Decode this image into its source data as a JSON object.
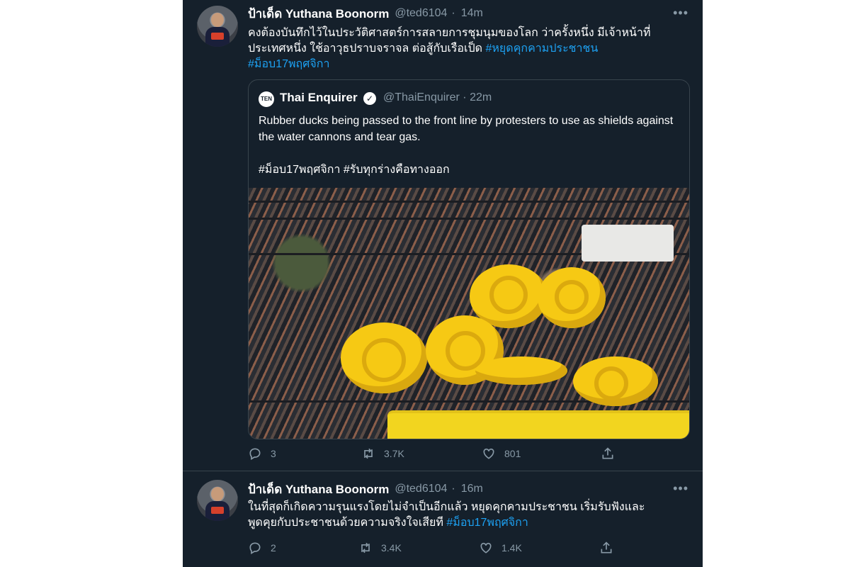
{
  "tweet1": {
    "name": "ป้าเด็ด Yuthana Boonorm",
    "handle": "@ted6104",
    "dot": "·",
    "time": "14m",
    "more": "•••",
    "text_line1": "คงต้องบันทึกไว้ในประวัติศาสตร์การสลายการชุมนุมของโลก ว่าครั้งหนึ่ง มีเจ้าหน้าที่",
    "text_line2": "ประเทศหนึ่ง ใช้อาวุธปราบจราจล ต่อสู้กับเรือเป็ด ",
    "hashtag1": "#หยุดคุกคามประชาชน",
    "hashtag2": "#ม็อบ17พฤศจิกา",
    "quote": {
      "logo": "TEN",
      "name": "Thai Enquirer",
      "verified": "✓",
      "handle": "@ThaiEnquirer",
      "dot": "·",
      "time": "22m",
      "text": "Rubber ducks being passed to the front line by protesters to use as shields against the water cannons and tear gas.",
      "hashtags": "#ม็อบ17พฤศจิกา #รับทุกร่างคือทางออก"
    },
    "replies": "3",
    "retweets": "3.7K",
    "likes": "801"
  },
  "tweet2": {
    "name": "ป้าเด็ด Yuthana Boonorm",
    "handle": "@ted6104",
    "dot": "·",
    "time": "16m",
    "more": "•••",
    "text_line1": "ในที่สุดก็เกิดความรุนแรงโดยไม่จำเป็นอีกแล้ว หยุดคุกคามประชาชน เริ่มรับฟังและ",
    "text_line2": "พูดคุยกับประชาชนด้วยความจริงใจเสียที ",
    "hashtag1": "#ม็อบ17พฤศจิกา",
    "replies": "2",
    "retweets": "3.4K",
    "likes": "1.4K"
  },
  "icons": {
    "reply": "reply-icon",
    "retweet": "retweet-icon",
    "like": "heart-icon",
    "share": "share-icon"
  },
  "colors": {
    "background": "#15202b",
    "text": "#ffffff",
    "muted": "#8899a6",
    "link": "#1da1f2",
    "border": "#38444d"
  }
}
